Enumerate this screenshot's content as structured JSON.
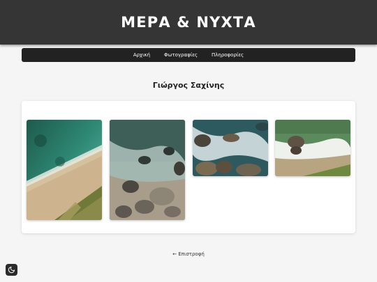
{
  "header": {
    "site_title": "ΜΕΡΑ & ΝΥΧΤΑ"
  },
  "nav": {
    "items": [
      "Αρχική",
      "Φωτογραφίες",
      "Πληροφορίες"
    ]
  },
  "main": {
    "title": "Γιώργος Σαχίνης"
  },
  "footer": {
    "back_label": "← Επιστροφή"
  },
  "theme_toggle": {
    "icon": "moon-icon"
  },
  "gallery": {
    "photos": [
      {
        "subject": "beach-aerial"
      },
      {
        "subject": "rocky-shore-waves"
      },
      {
        "subject": "waves-on-rocks"
      },
      {
        "subject": "rocky-coast-grass"
      }
    ]
  },
  "colors": {
    "header_bg": "#353535",
    "nav_bg": "#222222",
    "page_bg": "#f5f5f5",
    "card_bg": "#ffffff"
  }
}
